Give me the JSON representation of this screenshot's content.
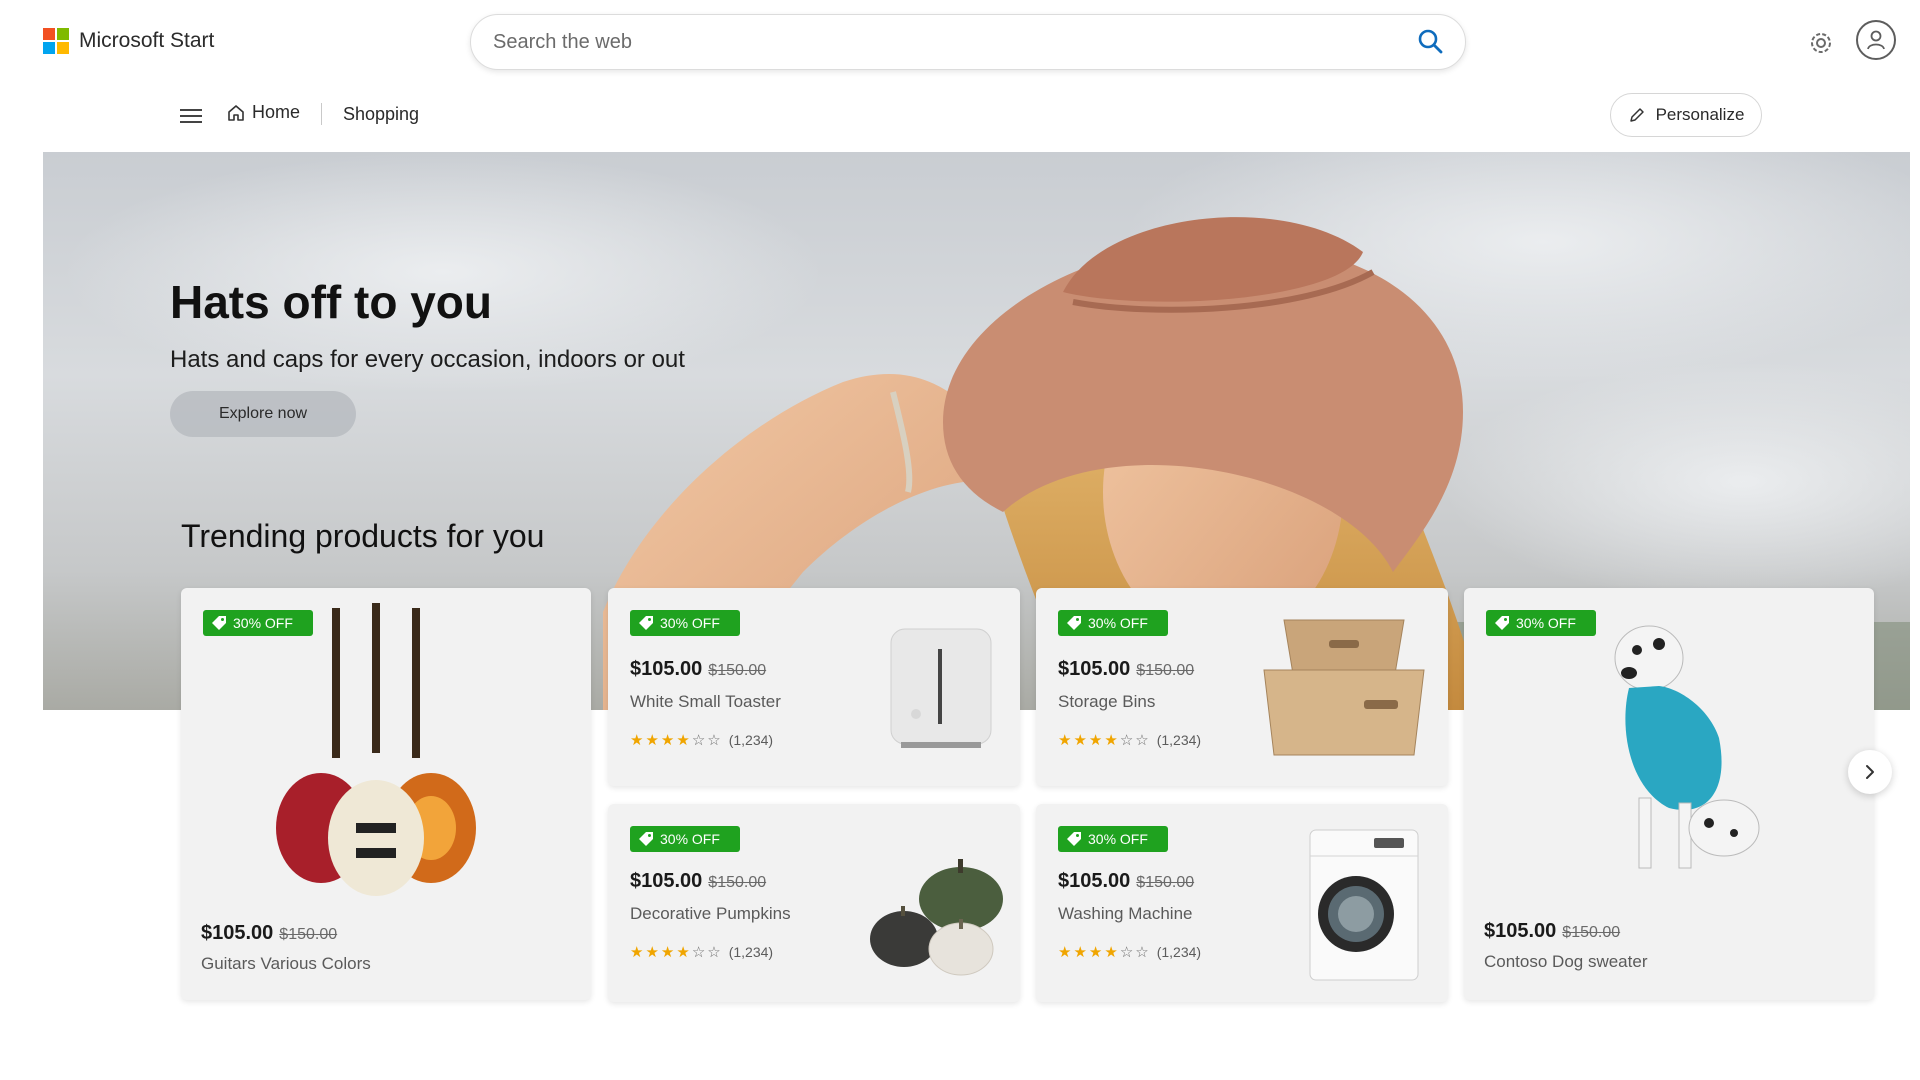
{
  "header": {
    "brand": "Microsoft Start",
    "search_placeholder": "Search the web",
    "icons": [
      "search-icon",
      "settings-icon",
      "profile-icon"
    ]
  },
  "nav": {
    "home_label": "Home",
    "shopping_label": "Shopping",
    "personalize_label": "Personalize"
  },
  "hero": {
    "title": "Hats off to you",
    "subtitle": "Hats and caps for every occasion, indoors or out",
    "cta": "Explore now"
  },
  "trending": {
    "title": "Trending products for you",
    "products": [
      {
        "badge": "30% OFF",
        "price": "$105.00",
        "old_price": "$150.00",
        "name": "Guitars Various Colors"
      },
      {
        "badge": "30% OFF",
        "price": "$105.00",
        "old_price": "$150.00",
        "name": "White Small Toaster",
        "rating": 4,
        "reviews": "(1,234)"
      },
      {
        "badge": "30% OFF",
        "price": "$105.00",
        "old_price": "$150.00",
        "name": "Storage Bins",
        "rating": 4,
        "reviews": "(1,234)"
      },
      {
        "badge": "30% OFF",
        "price": "$105.00",
        "old_price": "$150.00",
        "name": "Contoso Dog sweater"
      },
      {
        "badge": "30% OFF",
        "price": "$105.00",
        "old_price": "$150.00",
        "name": "Decorative Pumpkins",
        "rating": 4,
        "reviews": "(1,234)"
      },
      {
        "badge": "30% OFF",
        "price": "$105.00",
        "old_price": "$150.00",
        "name": "Washing Machine",
        "rating": 4,
        "reviews": "(1,234)"
      }
    ]
  },
  "colors": {
    "badge_green": "#1fa21f",
    "star_gold": "#f0a500",
    "ms_red": "#f25022",
    "ms_green": "#7fba00",
    "ms_blue": "#00a4ef",
    "ms_yellow": "#ffb900"
  }
}
